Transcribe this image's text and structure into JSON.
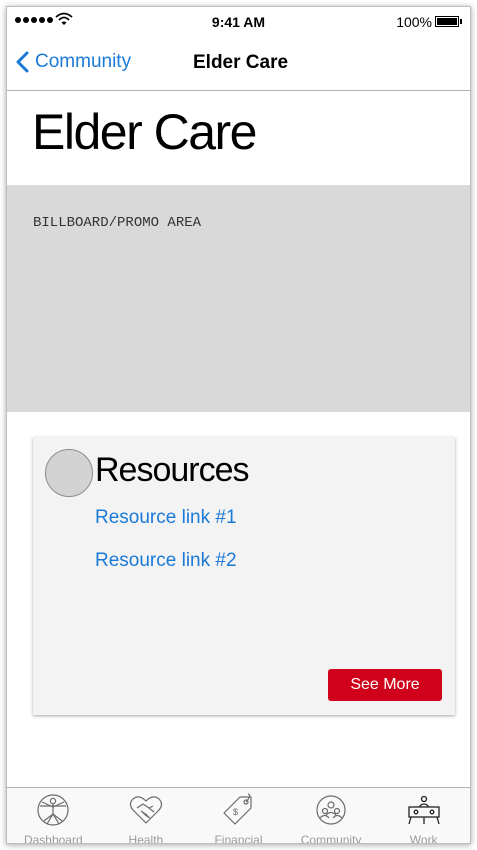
{
  "status_bar": {
    "time": "9:41 AM",
    "battery": "100%"
  },
  "nav": {
    "back_label": "Community",
    "title": "Elder Care"
  },
  "page": {
    "title": "Elder Care"
  },
  "billboard": {
    "label": "BILLBOARD/PROMO AREA"
  },
  "resources": {
    "title": "Resources",
    "links": [
      "Resource link #1",
      "Resource link #2"
    ],
    "see_more_label": "See More"
  },
  "tabs": [
    {
      "label": "Dashboard",
      "icon": "vitruvian-man-icon"
    },
    {
      "label": "Health",
      "icon": "heart-handshake-icon"
    },
    {
      "label": "Financial",
      "icon": "price-tag-icon"
    },
    {
      "label": "Community",
      "icon": "community-people-icon"
    },
    {
      "label": "Work",
      "icon": "meeting-table-icon"
    }
  ],
  "colors": {
    "link": "#1a7ad6",
    "accent_button": "#d0021b",
    "billboard_bg": "#d9d9d9",
    "card_bg": "#f3f3f3",
    "tab_label": "#9b9b9b"
  }
}
